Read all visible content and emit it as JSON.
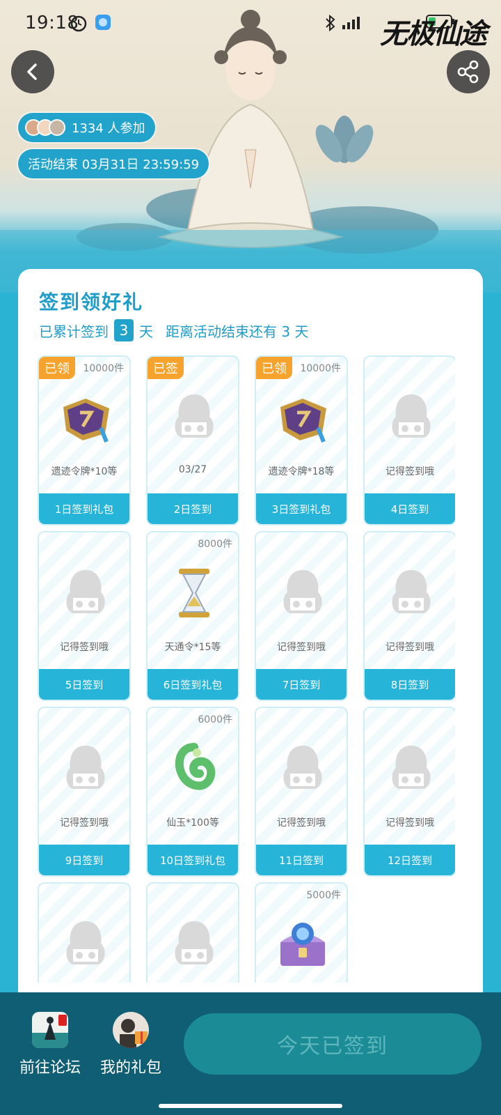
{
  "status_bar": {
    "time": "19:18",
    "battery": "4"
  },
  "header": {
    "game_logo": "无极仙途",
    "participants": "1334 人参加",
    "end_time": "活动结束 03月31日 23:59:59"
  },
  "card": {
    "title": "签到领好礼",
    "accum_prefix": "已累计签到",
    "accum_days": "3",
    "accum_suffix": "天",
    "remaining_text": "距离活动结束还有 3 天"
  },
  "tiles": [
    {
      "tag": "已领",
      "count": "10000件",
      "name": "遗迹令牌*10等",
      "day": "1日签到礼包",
      "icon": "token-icon"
    },
    {
      "tag": "已签",
      "count": "",
      "name": "03/27",
      "day": "2日签到",
      "icon": "placeholder-icon"
    },
    {
      "tag": "已领",
      "count": "10000件",
      "name": "遗迹令牌*18等",
      "day": "3日签到礼包",
      "icon": "token-icon"
    },
    {
      "tag": "",
      "count": "",
      "name": "记得签到哦",
      "day": "4日签到",
      "icon": "placeholder-icon"
    },
    {
      "tag": "",
      "count": "",
      "name": "记得签到哦",
      "day": "5日签到",
      "icon": "placeholder-icon"
    },
    {
      "tag": "",
      "count": "8000件",
      "name": "天通令*15等",
      "day": "6日签到礼包",
      "icon": "hourglass-icon"
    },
    {
      "tag": "",
      "count": "",
      "name": "记得签到哦",
      "day": "7日签到",
      "icon": "placeholder-icon"
    },
    {
      "tag": "",
      "count": "",
      "name": "记得签到哦",
      "day": "8日签到",
      "icon": "placeholder-icon"
    },
    {
      "tag": "",
      "count": "",
      "name": "记得签到哦",
      "day": "9日签到",
      "icon": "placeholder-icon"
    },
    {
      "tag": "",
      "count": "6000件",
      "name": "仙玉*100等",
      "day": "10日签到礼包",
      "icon": "jade-icon"
    },
    {
      "tag": "",
      "count": "",
      "name": "记得签到哦",
      "day": "11日签到",
      "icon": "placeholder-icon"
    },
    {
      "tag": "",
      "count": "",
      "name": "记得签到哦",
      "day": "12日签到",
      "icon": "placeholder-icon"
    },
    {
      "tag": "",
      "count": "",
      "name": "",
      "day": "",
      "icon": "placeholder-icon"
    },
    {
      "tag": "",
      "count": "",
      "name": "",
      "day": "",
      "icon": "placeholder-icon"
    },
    {
      "tag": "",
      "count": "5000件",
      "name": "",
      "day": "",
      "icon": "treasure-chest-icon"
    }
  ],
  "bottom_bar": {
    "forum_label": "前往论坛",
    "gift_label": "我的礼包",
    "sign_button": "今天已签到"
  },
  "colors": {
    "primary": "#22a3cc",
    "tag_orange": "#f5a32c",
    "bottom_bar": "#0f5e73"
  }
}
